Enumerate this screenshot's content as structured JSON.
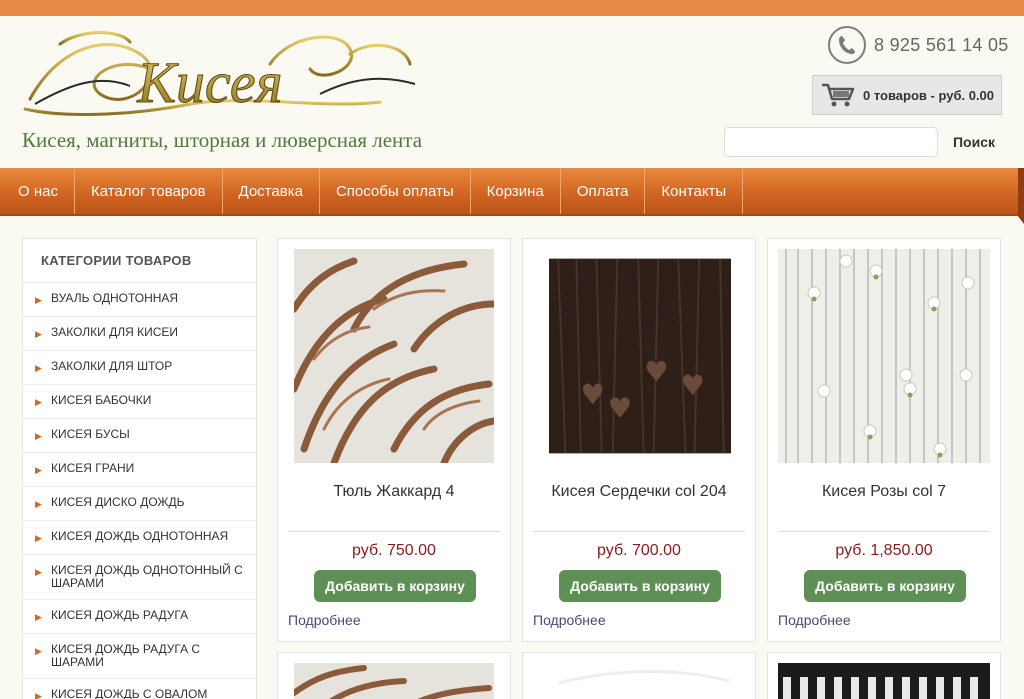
{
  "header": {
    "logo_text": "Кисея",
    "tagline": "Кисея, магниты, шторная и люверсная лента",
    "phone": "8 925 561 14 05",
    "cart_summary": "0 товаров - руб. 0.00",
    "search_placeholder": "",
    "search_button": "Поиск"
  },
  "nav": {
    "items": [
      {
        "label": "О нас"
      },
      {
        "label": "Каталог товаров"
      },
      {
        "label": "Доставка"
      },
      {
        "label": "Способы оплаты"
      },
      {
        "label": "Корзина"
      },
      {
        "label": "Оплата"
      },
      {
        "label": "Контакты"
      }
    ]
  },
  "sidebar": {
    "title": "КАТЕГОРИИ ТОВАРОВ",
    "items": [
      {
        "label": "Вуаль однотонная"
      },
      {
        "label": "Заколки для кисеи"
      },
      {
        "label": "Заколки для штор"
      },
      {
        "label": "Кисея бабочки"
      },
      {
        "label": "Кисея бусы"
      },
      {
        "label": "Кисея грани"
      },
      {
        "label": "Кисея диско дождь"
      },
      {
        "label": "Кисея дождь однотонная"
      },
      {
        "label": "Кисея дождь однотонный с шарами"
      },
      {
        "label": "Кисея дождь радуга"
      },
      {
        "label": "Кисея дождь радуга с шарами"
      },
      {
        "label": "Кисея дождь с овалом"
      }
    ]
  },
  "products": [
    {
      "name": "Тюль Жаккард 4",
      "price": "руб. 750.00",
      "button": "Добавить в корзину",
      "more": "Подробнее"
    },
    {
      "name": "Кисея Сердечки col 204",
      "price": "руб. 700.00",
      "button": "Добавить в корзину",
      "more": "Подробнее"
    },
    {
      "name": "Кисея Розы col 7",
      "price": "руб. 1,850.00",
      "button": "Добавить в корзину",
      "more": "Подробнее"
    }
  ],
  "colors": {
    "accent": "#e48a45",
    "nav": "#d26521",
    "button": "#5e9055",
    "price": "#8b1a1a",
    "tagline": "#4e7a3a"
  },
  "icons": {
    "phone": "phone-icon",
    "cart": "cart-icon",
    "arrow": "triangle-right-icon"
  }
}
